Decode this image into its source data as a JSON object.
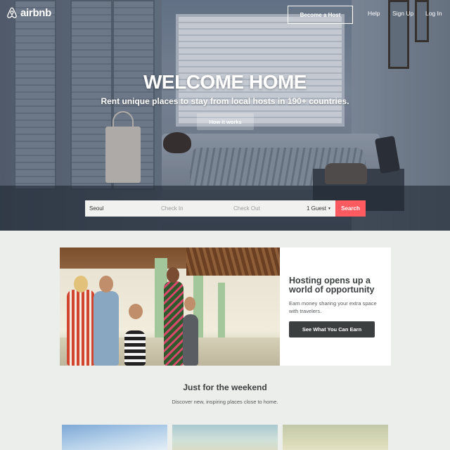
{
  "brand": {
    "name": "airbnb",
    "accent": "#ff5a5f"
  },
  "nav": {
    "become_host": "Become a Host",
    "help": "Help",
    "sign_up": "Sign Up",
    "log_in": "Log In"
  },
  "hero": {
    "title": "WELCOME HOME",
    "subtitle": "Rent unique places to stay from local hosts in 190+ countries.",
    "how_it_works": "How it works"
  },
  "search": {
    "city": "Seoul",
    "check_in_placeholder": "Check In",
    "check_out_placeholder": "Check Out",
    "guests": "1 Guest",
    "button": "Search"
  },
  "hosting": {
    "title": "Hosting opens up a world of opportunity",
    "description": "Earn money sharing your extra space with travelers.",
    "button": "See What You Can Earn"
  },
  "weekend": {
    "title": "Just for the weekend",
    "subtitle": "Discover new, inspiring places close to home."
  },
  "icons": {
    "logo": "airbnb-belo-icon",
    "guest_caret": "caret-down-icon"
  }
}
